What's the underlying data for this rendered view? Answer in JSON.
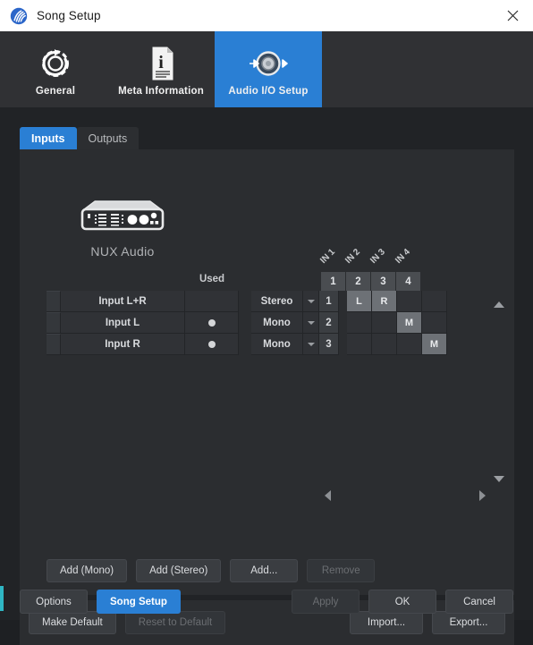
{
  "window": {
    "title": "Song Setup",
    "app_icon": "cantabile-logo-icon",
    "close_label": "✕"
  },
  "icon_tabs": [
    {
      "label": "General",
      "icon": "gear-refresh-icon",
      "selected": false
    },
    {
      "label": "Meta Information",
      "icon": "document-info-icon",
      "selected": false
    },
    {
      "label": "Audio I/O Setup",
      "icon": "audio-io-icon",
      "selected": true
    }
  ],
  "tabs": [
    {
      "label": "Inputs",
      "active": true
    },
    {
      "label": "Outputs",
      "active": false
    }
  ],
  "device": {
    "name": "NUX Audio",
    "icon": "audio-interface-icon"
  },
  "grid": {
    "used_header": "Used",
    "channel_labels": [
      "IN 1",
      "IN 2",
      "IN 3",
      "IN 4"
    ],
    "channel_numbers": [
      "1",
      "2",
      "3",
      "4"
    ],
    "rows": [
      {
        "name": "Input L+R",
        "used": false,
        "mode": "Stereo",
        "port": "1",
        "matrix": [
          "L",
          "R",
          "",
          ""
        ]
      },
      {
        "name": "Input L",
        "used": true,
        "mode": "Mono",
        "port": "2",
        "matrix": [
          "",
          "",
          "M",
          ""
        ]
      },
      {
        "name": "Input R",
        "used": true,
        "mode": "Mono",
        "port": "3",
        "matrix": [
          "",
          "",
          "",
          "M"
        ]
      }
    ]
  },
  "scroll": {
    "up": "scroll-up-arrow",
    "down": "scroll-down-arrow",
    "left": "scroll-left-arrow",
    "right": "scroll-right-arrow"
  },
  "row_buttons": [
    {
      "label": "Add (Mono)",
      "disabled": false
    },
    {
      "label": "Add (Stereo)",
      "disabled": false
    },
    {
      "label": "Add...",
      "disabled": false
    },
    {
      "label": "Remove",
      "disabled": true
    }
  ],
  "defaults_bar": {
    "left": [
      {
        "label": "Make Default",
        "disabled": false
      },
      {
        "label": "Reset to Default",
        "disabled": true
      }
    ],
    "right": [
      {
        "label": "Import...",
        "disabled": false
      },
      {
        "label": "Export...",
        "disabled": false
      }
    ]
  },
  "footer": {
    "left": [
      {
        "label": "Options",
        "disabled": false,
        "primary": false
      },
      {
        "label": "Song Setup",
        "disabled": false,
        "primary": true
      }
    ],
    "right": [
      {
        "label": "Apply",
        "disabled": true,
        "primary": false
      },
      {
        "label": "OK",
        "disabled": false,
        "primary": false
      },
      {
        "label": "Cancel",
        "disabled": false,
        "primary": false
      }
    ]
  },
  "colors": {
    "accent": "#2a7fd4",
    "panel": "#2b2d30",
    "dialog": "#212326",
    "iconbar": "#303134",
    "titlebar": "#ffffff",
    "meter": "#6a6648",
    "edge_strip": "#2fb6c4"
  }
}
